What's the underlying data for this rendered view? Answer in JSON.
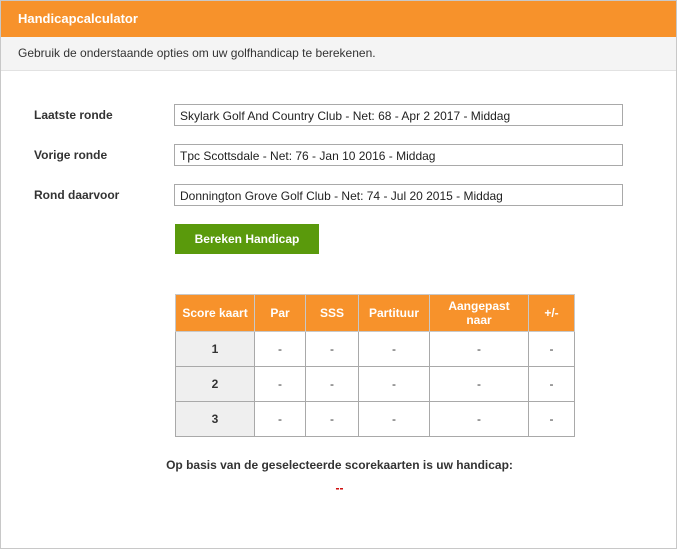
{
  "header": {
    "title": "Handicapcalculator"
  },
  "intro": {
    "text": "Gebruik de onderstaande opties om uw golfhandicap te berekenen."
  },
  "rounds": [
    {
      "label": "Laatste ronde",
      "value": "Skylark Golf And Country Club - Net: 68 - Apr 2 2017 - Middag"
    },
    {
      "label": "Vorige ronde",
      "value": "Tpc Scottsdale - Net: 76 - Jan 10 2016 - Middag"
    },
    {
      "label": "Rond daarvoor",
      "value": "Donnington Grove Golf Club - Net: 74 - Jul 20 2015 - Middag"
    }
  ],
  "button": {
    "label": "Bereken Handicap"
  },
  "table": {
    "headers": [
      "Score kaart",
      "Par",
      "SSS",
      "Partituur",
      "Aangepast naar",
      "+/-"
    ],
    "rows": [
      [
        "1",
        "-",
        "-",
        "-",
        "-",
        "-"
      ],
      [
        "2",
        "-",
        "-",
        "-",
        "-",
        "-"
      ],
      [
        "3",
        "-",
        "-",
        "-",
        "-",
        "-"
      ]
    ]
  },
  "result": {
    "label": "Op basis van de geselecteerde scorekaarten is uw handicap:",
    "value": "--"
  },
  "colors": {
    "header": "#f7922b",
    "button": "#5a9a0c",
    "result_value": "#cc0000"
  }
}
